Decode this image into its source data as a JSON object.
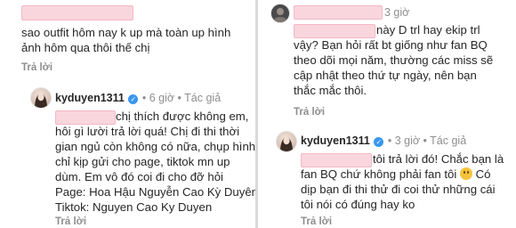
{
  "left": {
    "top_comment": {
      "lines": [
        "sao outfit hôm nay k up mà toàn up hình",
        "ảnh hôm qua thôi thế chị"
      ],
      "reply": "Trả lời"
    },
    "reply_comment": {
      "username": "kyduyen1311",
      "verified_icon": "✓",
      "separator": "•",
      "time": "6 giờ",
      "author_tag": "Tác giả",
      "lines": [
        "chị thích được không em,",
        "hôi gì lười trả lời quá! Chị đi thi thời",
        "gian ngủ còn không có nữa, chụp hình",
        "chỉ kịp gửi cho page, tiktok mn up",
        "dùm. Em vô đó coi đi cho đỡ hỏi",
        "Page: Hoa Hậu Nguyễn Cao Kỳ Duyên",
        "Tiktok: Nguyen Cao Ky Duyen"
      ],
      "reply": "Trả lời"
    }
  },
  "right": {
    "top_comment": {
      "time": "3 giờ",
      "lines": [
        "này D trl hay ekip trl",
        "vậy? Bạn hỏi rất bt giống như fan BQ",
        "theo dõi mọi năm, thường các miss sẽ",
        "cập nhật theo thứ tự ngày, nên bạn",
        "thắc mắc thôi."
      ],
      "reply": "Trả lời"
    },
    "reply_comment": {
      "username": "kyduyen1311",
      "verified_icon": "✓",
      "separator": "•",
      "time": "3 giờ",
      "author_tag": "Tác giả",
      "lines": [
        "tôi trả lời đó! Chắc bạn là",
        "fan BQ chứ không phải fan tôi",
        "Có",
        "dịp bạn đi thi thử đi coi thử những cái",
        "tôi nói có đúng hay ko"
      ],
      "reply": "Trả lời"
    }
  }
}
